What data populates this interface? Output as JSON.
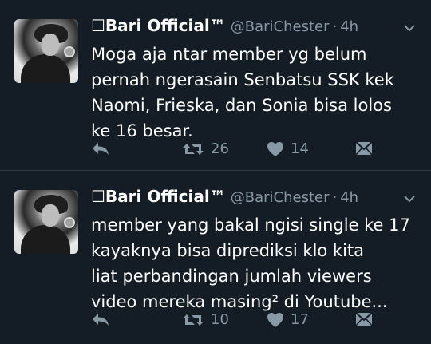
{
  "tweets": [
    {
      "name": "☐Bari Official™",
      "handle": "@BariChester",
      "separator": "·",
      "time": "4h",
      "text": "Moga aja ntar member yg belum\npernah ngerasain Senbatsu SSK kek\nNaomi, Frieska, dan Sonia bisa lolos\nke 16 besar.",
      "retweets": "26",
      "likes": "14"
    },
    {
      "name": "☐Bari Official™",
      "handle": "@BariChester",
      "separator": "·",
      "time": "4h",
      "text": "member yang bakal ngisi single ke 17\nkayaknya bisa diprediksi klo kita\nliat perbandingan jumlah viewers\nvideo mereka masing² di Youtube...",
      "retweets": "10",
      "likes": "17"
    }
  ],
  "icons": {
    "reply": "reply-icon",
    "retweet": "retweet-icon",
    "like": "heart-icon",
    "dm": "direct-message-icon",
    "menu": "chevron-down-icon"
  },
  "colors": {
    "background": "#141d26",
    "muted": "#8899a6",
    "divider": "#2b3a48"
  }
}
